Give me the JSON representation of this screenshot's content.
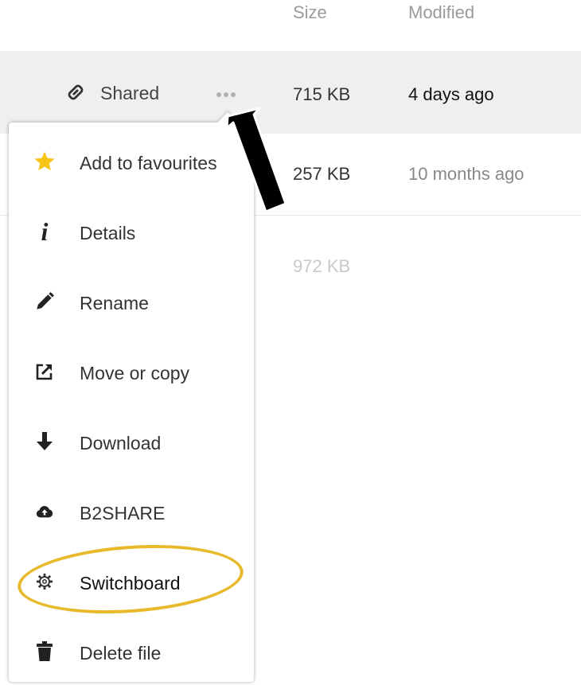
{
  "header": {
    "size_label": "Size",
    "modified_label": "Modified"
  },
  "rows": [
    {
      "share_label": "Shared",
      "size": "715 KB",
      "modified": "4 days ago",
      "highlighted": true
    },
    {
      "size": "257 KB",
      "modified": "10 months ago"
    },
    {
      "size": "972 KB"
    }
  ],
  "menu": {
    "items": [
      {
        "label": "Add to favourites",
        "icon": "star-icon"
      },
      {
        "label": "Details",
        "icon": "info-icon"
      },
      {
        "label": "Rename",
        "icon": "pencil-icon"
      },
      {
        "label": "Move or copy",
        "icon": "external-link-icon"
      },
      {
        "label": "Download",
        "icon": "download-arrow-icon"
      },
      {
        "label": "B2SHARE",
        "icon": "cloud-upload-icon"
      },
      {
        "label": "Switchboard",
        "icon": "gear-icon"
      },
      {
        "label": "Delete file",
        "icon": "trash-icon"
      }
    ]
  },
  "annotations": {
    "circle_color": "#e8b92b",
    "arrow_color": "#000000"
  },
  "colors": {
    "star": "#f5c518",
    "selected_row": "#efefef"
  }
}
